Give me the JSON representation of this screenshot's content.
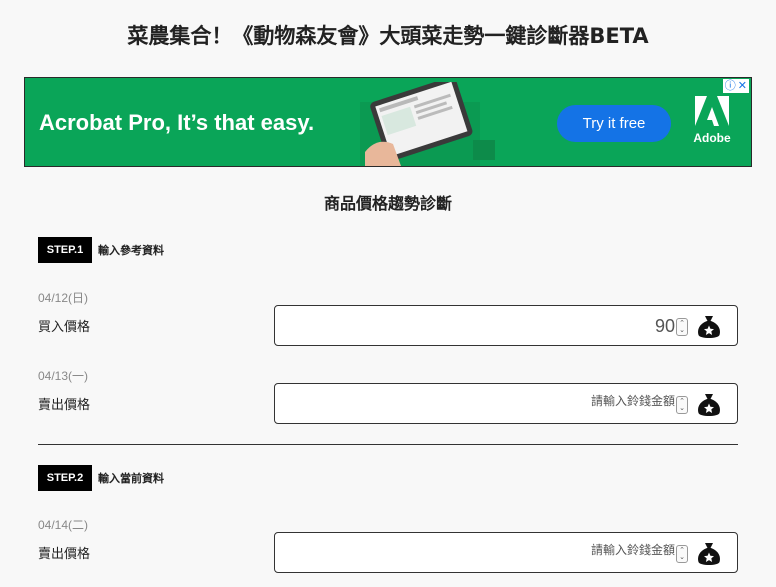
{
  "page": {
    "title": "菜農集合！《動物森友會》大頭菜走勢一鍵診斷器BETA"
  },
  "ad": {
    "headline": "Acrobat Pro, It’s that easy.",
    "cta": "Try it free",
    "brand": "Adobe",
    "choices_icons": [
      "info-icon",
      "close-icon"
    ],
    "colors": {
      "background": "#0aa558",
      "cta": "#1473e6"
    }
  },
  "section": {
    "title": "商品價格趨勢診斷"
  },
  "step1": {
    "badge": "STEP.1",
    "label": "輸入參考資料",
    "buy": {
      "date": "04/12(日)",
      "label": "買入價格",
      "value": "90"
    },
    "sell": {
      "date": "04/13(一)",
      "label": "賣出價格",
      "placeholder": "請輸入鈴錢金額"
    }
  },
  "step2": {
    "badge": "STEP.2",
    "label": "輸入當前資料",
    "sell": {
      "date": "04/14(二)",
      "label": "賣出價格",
      "placeholder": "請輸入鈴錢金額"
    }
  },
  "icons": {
    "money_bag": "money-bag-icon",
    "spinner": "number-spinner-icon"
  }
}
